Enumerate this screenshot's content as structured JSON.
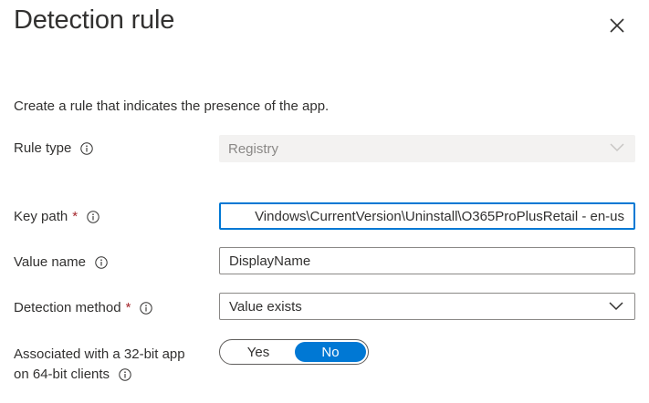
{
  "panel": {
    "title": "Detection rule",
    "description": "Create a rule that indicates the presence of the app."
  },
  "form": {
    "rule_type": {
      "label": "Rule type",
      "value": "Registry"
    },
    "key_path": {
      "label": "Key path",
      "required_mark": "*",
      "value": "Vindows\\CurrentVersion\\Uninstall\\O365ProPlusRetail - en-us"
    },
    "value_name": {
      "label": "Value name",
      "value": "DisplayName"
    },
    "detection_method": {
      "label": "Detection method",
      "required_mark": "*",
      "value": "Value exists"
    },
    "associated_32bit": {
      "label_line1": "Associated with a 32-bit app",
      "label_line2": "on 64-bit clients",
      "options": [
        "Yes",
        "No"
      ],
      "selected": "No"
    }
  },
  "colors": {
    "accent": "#0078d4",
    "required": "#a4262c",
    "disabled_bg": "#f3f2f1",
    "border": "#8a8886"
  },
  "icons": {
    "close": "close-icon",
    "info": "info-icon",
    "dropdown": "chevron-down-icon"
  }
}
